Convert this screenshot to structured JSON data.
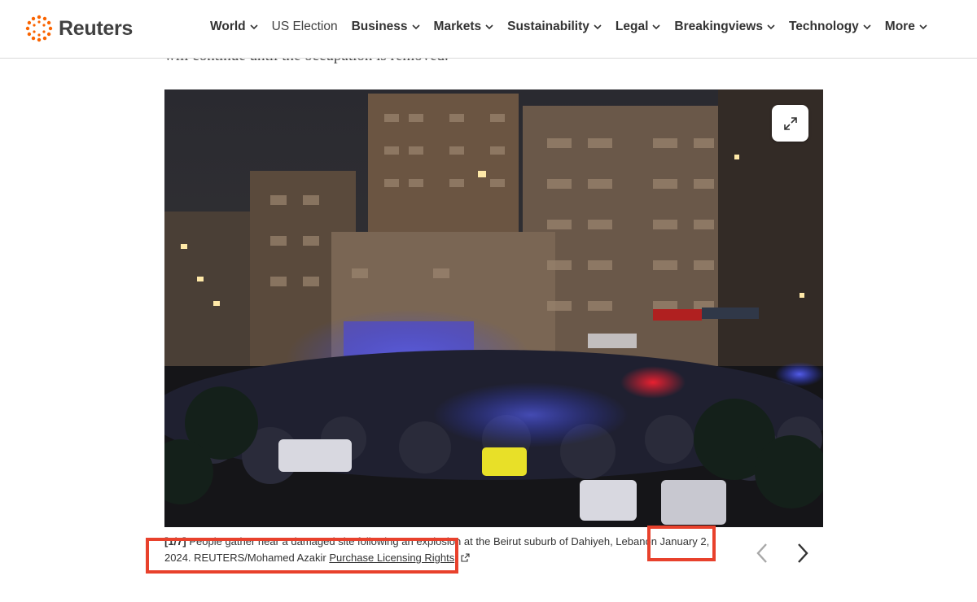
{
  "brand": {
    "name": "Reuters",
    "accent_color": "#fa6400"
  },
  "nav": {
    "items": [
      {
        "label": "World",
        "dropdown": true
      },
      {
        "label": "US Election",
        "dropdown": false
      },
      {
        "label": "Business",
        "dropdown": true
      },
      {
        "label": "Markets",
        "dropdown": true
      },
      {
        "label": "Sustainability",
        "dropdown": true
      },
      {
        "label": "Legal",
        "dropdown": true
      },
      {
        "label": "Breakingviews",
        "dropdown": true
      },
      {
        "label": "Technology",
        "dropdown": true
      },
      {
        "label": "More",
        "dropdown": true
      }
    ]
  },
  "article": {
    "prev_paragraph_tail": "will continue until the occupation is removed."
  },
  "gallery": {
    "expand_icon": "expand-icon",
    "caption_counter": "[1/7]",
    "caption_text": "People gather near a damaged site following an explosion at the Beirut suburb of Dahiyeh, Lebanon January 2, 2024. REUTERS/Mohamed Azakir",
    "licensing_link": "Purchase Licensing Rights",
    "prev_icon": "chevron-left-icon",
    "next_icon": "chevron-right-icon"
  },
  "annotations": {
    "highlight_color": "#e8412c"
  }
}
